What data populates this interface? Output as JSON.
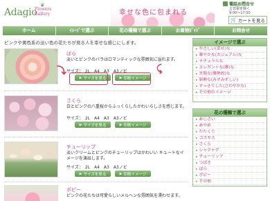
{
  "header": {
    "logo_main": "Adagio",
    "logo_sub_line1": "Flowers",
    "logo_sub_line2": "Gallery",
    "tagline": "幸せな色に包まれる",
    "contact_title": "電話お問合せ",
    "contact_days": "土日祝を除く",
    "contact_hours": "9:00～17:00",
    "cart_label": "カートを見る"
  },
  "nav": [
    "ホーム",
    "ｲﾒｰｼﾞで選ぶ",
    "花の種類で選ぶ",
    "お買物ｶﾞｲﾄﾞ",
    "お問合せ"
  ],
  "intro": "ピンクや黄色系の淡い色の花たちが見る人を幸せな感じにします。",
  "products": [
    {
      "name": "ばら",
      "desc": "淡いとピンクのバラはロマンティックな雰囲気に溢れます。",
      "sizes": "サイズ：　2L　A4　A3　A3ノビ",
      "size_btn": "サイズを見る",
      "print_btn": "印刷イメージ"
    },
    {
      "name": "さくら",
      "desc": "白とピンクの八重桜からふっくらしたかわいらしさを感じます。",
      "sizes": "サイズ：　2L　A4　A3　A3ノビ",
      "size_btn": "サイズを見る",
      "print_btn": "印刷イメージ"
    },
    {
      "name": "チューリップ",
      "desc": "淡いクリームとピンクのチューリップはかわいい キュートなイメージを演出します。",
      "sizes": "サイズ：　2L　A4　A3　A3ノビ",
      "size_btn": "サイズを見る",
      "print_btn": "印刷イメージ"
    },
    {
      "name": "ポピー",
      "desc": "ピンクの花たちは可愛らしいメルヘンな雰囲気を漂わせます。"
    }
  ],
  "sidebar": {
    "theme_title": "イメージで選ぶ",
    "themes": [
      "やさしい(幸せ)な",
      "華やかな(カジュアル)な",
      "ナチュラルな",
      "エレガントな(華)な",
      "大胆な(情熱的)な",
      "新鮮な(みずみずしい)",
      "すっきりした(さわやかな)",
      "その他のイメージ"
    ],
    "type_title": "花の種類で選ぶ",
    "types": [
      "あじさい",
      "あやめ",
      "かたくり",
      "コスモス",
      "さくら",
      "シャクナゲ",
      "チューリップ",
      "つばき",
      "ばら",
      "ポピー",
      "その他"
    ]
  },
  "colors": {
    "accent_green": "#5e9a4e",
    "accent_pink": "#d0467f",
    "highlight_red": "#e0304a"
  }
}
